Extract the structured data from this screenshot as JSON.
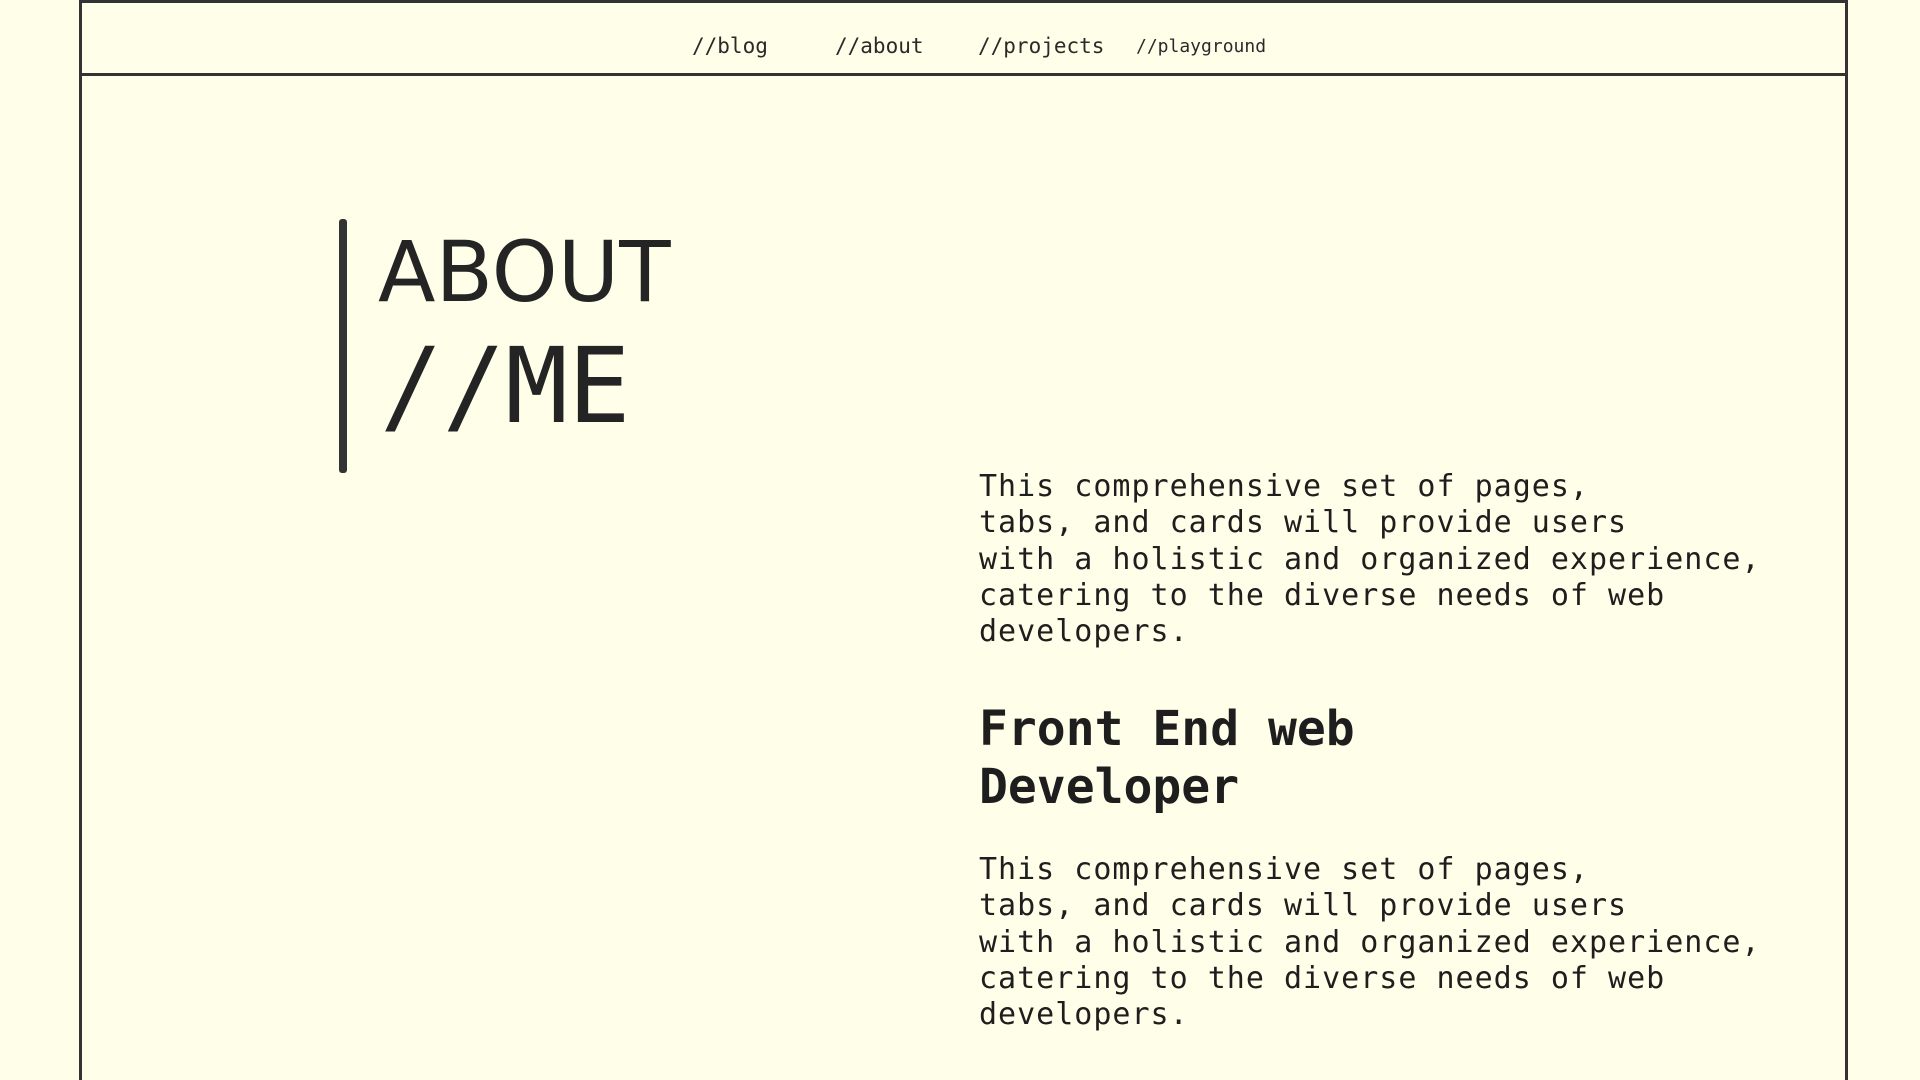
{
  "nav": {
    "blog": "//blog",
    "about": "//about",
    "projects": "//projects",
    "playground": "//playground"
  },
  "hero": {
    "title_line1": "ABOUT",
    "title_line2": "//ME"
  },
  "content": {
    "intro": "This comprehensive set of pages,\ntabs, and cards will provide users\nwith a holistic and organized experience,\ncatering to the diverse needs of web\ndevelopers.",
    "role_title": "Front End web\nDeveloper",
    "role_description": "This comprehensive set of pages,\ntabs, and cards will provide users\nwith a holistic and organized experience,\ncatering to the diverse needs of web\ndevelopers."
  },
  "colors": {
    "background": "#fffee8",
    "ink": "#242424",
    "border": "#333333"
  }
}
